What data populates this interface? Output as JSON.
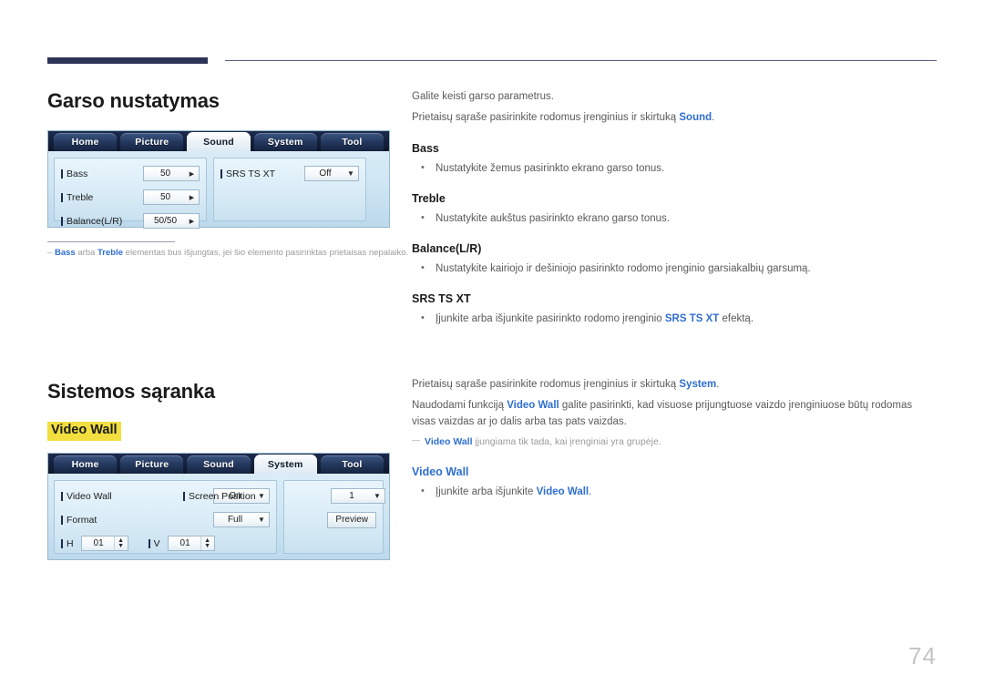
{
  "page": {
    "number": "74"
  },
  "sections": {
    "sound": {
      "heading": "Garso nustatymas",
      "intro1": "Galite keisti garso parametrus.",
      "intro2_pre": "Prietaisų sąraše pasirinkite rodomus įrenginius ir skirtuką ",
      "intro2_link": "Sound",
      "intro2_post": ".",
      "note_dash": "–",
      "note_a": "Bass",
      "note_mid": " arba ",
      "note_b": "Treble",
      "note_tail": " elementas bus išjungtas, jei šio elemento pasirinktas prietaisas nepalaiko.",
      "items": [
        {
          "title": "Bass",
          "bullet_pre": "Nustatykite žemus pasirinkto ekrano garso tonus.",
          "bullet_link": "",
          "bullet_post": ""
        },
        {
          "title": "Treble",
          "bullet_pre": "Nustatykite aukštus pasirinkto ekrano garso tonus.",
          "bullet_link": "",
          "bullet_post": ""
        },
        {
          "title": "Balance(L/R)",
          "bullet_pre": "Nustatykite kairiojo ir dešiniojo pasirinkto rodomo įrenginio garsiakalbių garsumą.",
          "bullet_link": "",
          "bullet_post": ""
        },
        {
          "title": "SRS TS XT",
          "bullet_pre": "Įjunkite arba išjunkite pasirinkto rodomo įrenginio ",
          "bullet_link": "SRS TS XT",
          "bullet_post": " efektą."
        }
      ]
    },
    "system": {
      "heading": "Sistemos sąranka",
      "highlight_label": "Video Wall",
      "intro1_pre": "Prietaisų sąraše pasirinkite rodomus įrenginius ir skirtuką ",
      "intro1_link": "System",
      "intro1_post": ".",
      "intro2_pre": "Naudodami funkciją ",
      "intro2_link": "Video Wall",
      "intro2_post": " galite pasirinkti, kad visuose prijungtuose vaizdo įrenginiuose būtų rodomas visas vaizdas ar jo dalis arba tas pats vaizdas.",
      "note_link": "Video Wall",
      "note_tail": " įjungiama tik tada, kai įrenginiai yra grupėje.",
      "items": [
        {
          "title": "Video Wall",
          "bullet_pre": "Įjunkite arba išjunkite ",
          "bullet_link": "Video Wall",
          "bullet_post": "."
        }
      ]
    }
  },
  "osd_sound": {
    "tabs": [
      {
        "label": "Home",
        "active": false
      },
      {
        "label": "Picture",
        "active": false
      },
      {
        "label": "Sound",
        "active": true
      },
      {
        "label": "System",
        "active": false
      },
      {
        "label": "Tool",
        "active": false
      }
    ],
    "left_fields": [
      {
        "label": "Bass",
        "value": "50",
        "control": "stepper-right"
      },
      {
        "label": "Treble",
        "value": "50",
        "control": "stepper-right"
      },
      {
        "label": "Balance(L/R)",
        "value": "50/50",
        "control": "stepper-right"
      }
    ],
    "right_fields": [
      {
        "label": "SRS TS XT",
        "value": "Off",
        "control": "dropdown"
      }
    ]
  },
  "osd_system": {
    "tabs": [
      {
        "label": "Home",
        "active": false
      },
      {
        "label": "Picture",
        "active": false
      },
      {
        "label": "Sound",
        "active": false
      },
      {
        "label": "System",
        "active": true
      },
      {
        "label": "Tool",
        "active": false
      }
    ],
    "left_fields": [
      {
        "label": "Video Wall",
        "value": "On",
        "control": "dropdown"
      },
      {
        "label": "Format",
        "value": "Full",
        "control": "dropdown"
      }
    ],
    "hv": [
      {
        "label": "H",
        "value": "01"
      },
      {
        "label": "V",
        "value": "01"
      }
    ],
    "right_fields": [
      {
        "label": "Screen Position",
        "value": "1",
        "control": "dropdown"
      }
    ],
    "preview_button": "Preview"
  },
  "colors": {
    "accent_blue": "#2f6fd0",
    "header_navy": "#2e3457",
    "highlight_yellow": "#f2df3f"
  }
}
